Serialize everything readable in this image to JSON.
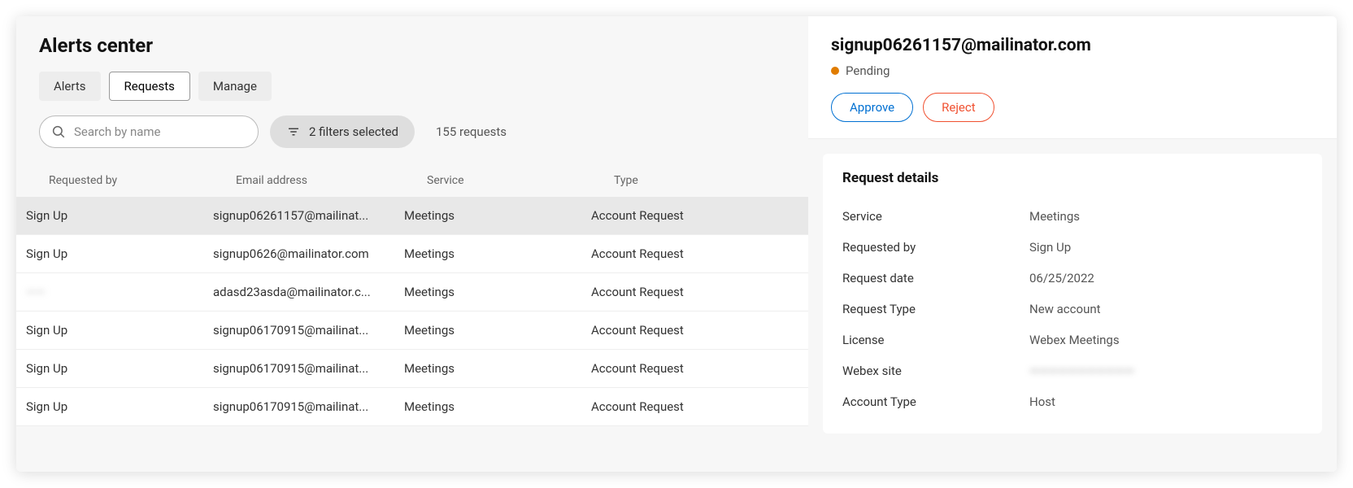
{
  "page_title": "Alerts center",
  "tabs": [
    {
      "label": "Alerts",
      "active": false
    },
    {
      "label": "Requests",
      "active": true
    },
    {
      "label": "Manage",
      "active": false
    }
  ],
  "search": {
    "placeholder": "Search by name",
    "value": ""
  },
  "filter_button": "2 filters selected",
  "count_label": "155 requests",
  "columns": {
    "requested_by": "Requested by",
    "email": "Email address",
    "service": "Service",
    "type": "Type"
  },
  "rows": [
    {
      "requested_by": "Sign Up",
      "email": "signup06261157@mailinat...",
      "service": "Meetings",
      "type": "Account Request",
      "selected": true,
      "blurred": false
    },
    {
      "requested_by": "Sign Up",
      "email": "signup0626@mailinator.com",
      "service": "Meetings",
      "type": "Account Request",
      "selected": false,
      "blurred": false
    },
    {
      "requested_by": "——",
      "email": "adasd23asda@mailinator.c...",
      "service": "Meetings",
      "type": "Account Request",
      "selected": false,
      "blurred": true
    },
    {
      "requested_by": "Sign Up",
      "email": "signup06170915@mailinat...",
      "service": "Meetings",
      "type": "Account Request",
      "selected": false,
      "blurred": false
    },
    {
      "requested_by": "Sign Up",
      "email": "signup06170915@mailinat...",
      "service": "Meetings",
      "type": "Account Request",
      "selected": false,
      "blurred": false
    },
    {
      "requested_by": "Sign Up",
      "email": "signup06170915@mailinat...",
      "service": "Meetings",
      "type": "Account Request",
      "selected": false,
      "blurred": false
    }
  ],
  "detail": {
    "title": "signup06261157@mailinator.com",
    "status": "Pending",
    "approve_label": "Approve",
    "reject_label": "Reject",
    "card_title": "Request details",
    "fields": [
      {
        "label": "Service",
        "value": "Meetings",
        "blurred": false
      },
      {
        "label": "Requested by",
        "value": "Sign Up",
        "blurred": false
      },
      {
        "label": "Request date",
        "value": "06/25/2022",
        "blurred": false
      },
      {
        "label": "Request Type",
        "value": "New account",
        "blurred": false
      },
      {
        "label": "License",
        "value": "Webex Meetings",
        "blurred": false
      },
      {
        "label": "Webex site",
        "value": "———————————",
        "blurred": true
      },
      {
        "label": "Account Type",
        "value": "Host",
        "blurred": false
      }
    ]
  }
}
